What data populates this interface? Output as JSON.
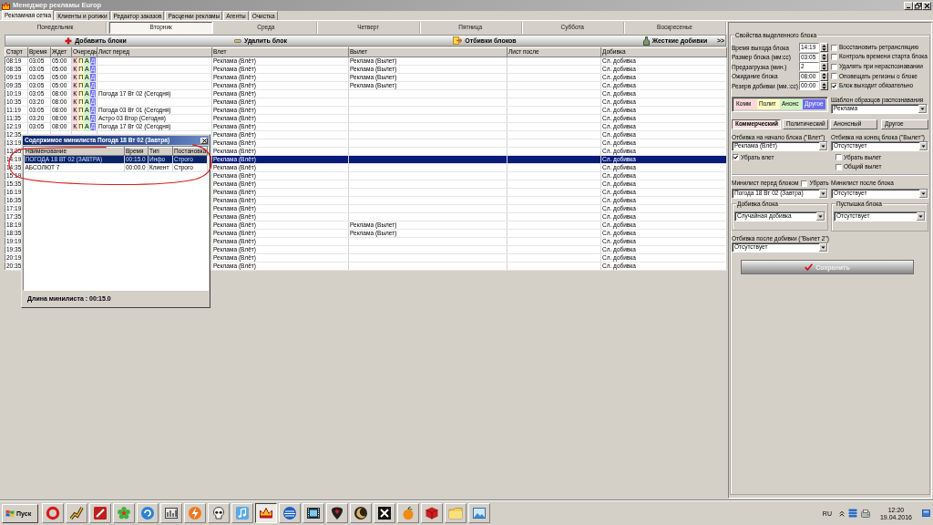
{
  "window": {
    "title": "Менеджер рекламы Europ"
  },
  "tabs": [
    {
      "label": "Рекламная сетка",
      "selected": true
    },
    {
      "label": "Клиенты и ролики",
      "selected": false
    },
    {
      "label": "Редактор заказов",
      "selected": false
    },
    {
      "label": "Расценки рекламы",
      "selected": false
    },
    {
      "label": "Агенты",
      "selected": false
    },
    {
      "label": "Очистка",
      "selected": false
    }
  ],
  "day_tabs": [
    {
      "label": "Понедельник",
      "selected": false
    },
    {
      "label": "Вторник",
      "selected": true
    },
    {
      "label": "Среда",
      "selected": false
    },
    {
      "label": "Четверг",
      "selected": false
    },
    {
      "label": "Пятница",
      "selected": false
    },
    {
      "label": "Суббота",
      "selected": false
    },
    {
      "label": "Воскресенье",
      "selected": false
    }
  ],
  "toolbar": [
    {
      "label": "Добавить блоки",
      "kind": "add"
    },
    {
      "label": "Удалить блок",
      "kind": "delete"
    },
    {
      "label": "Отбивки блоков",
      "kind": "jingles"
    },
    {
      "label": "Жесткие добивки",
      "kind": "fillers"
    },
    {
      "label": ">>",
      "kind": "more"
    }
  ],
  "table": {
    "columns": [
      "Старт",
      "Время",
      "Ждет",
      "Очередь",
      "Лист перед",
      "Влет",
      "Вылет",
      "Лист после",
      "Добивка"
    ],
    "rows": [
      {
        "start": "08:19",
        "time": "03:05",
        "wait": "05:00",
        "queue": [
          "К",
          "П",
          "А",
          "Д"
        ],
        "jingle_in": "Реклама (Влёт)",
        "jingle_out": "Реклама (Вылет)",
        "filler": "Сл. добивка",
        "selected": false
      },
      {
        "start": "08:35",
        "time": "03:05",
        "wait": "05:00",
        "queue": [
          "К",
          "П",
          "А",
          "Д"
        ],
        "jingle_in": "Реклама (Влёт)",
        "jingle_out": "Реклама (Вылет)",
        "filler": "Сл. добивка",
        "selected": false
      },
      {
        "start": "09:19",
        "time": "03:05",
        "wait": "05:00",
        "queue": [
          "К",
          "П",
          "А",
          "Д"
        ],
        "jingle_in": "Реклама (Влёт)",
        "jingle_out": "Реклама (Вылет)",
        "filler": "Сл. добивка",
        "selected": false
      },
      {
        "start": "09:35",
        "time": "03:05",
        "wait": "05:00",
        "queue": [
          "К",
          "П",
          "А",
          "Д"
        ],
        "jingle_in": "Реклама (Влёт)",
        "jingle_out": "Реклама (Вылет)",
        "filler": "Сл. добивка",
        "selected": false
      },
      {
        "start": "10:19",
        "time": "03:05",
        "wait": "08:00",
        "queue": [
          "К",
          "П",
          "А",
          "Д"
        ],
        "list_before": "Погода 17 Вт 02 (Сегодня)",
        "jingle_in": "Реклама (Влёт)",
        "filler": "Сл. добивка",
        "selected": false
      },
      {
        "start": "10:35",
        "time": "03:20",
        "wait": "08:00",
        "queue": [
          "К",
          "П",
          "А",
          "Д"
        ],
        "jingle_in": "Реклама (Влёт)",
        "filler": "Сл. добивка",
        "selected": false
      },
      {
        "start": "11:19",
        "time": "03:05",
        "wait": "08:00",
        "queue": [
          "К",
          "П",
          "А",
          "Д"
        ],
        "list_before": "Погода 03 Вт 01 (Сегодня)",
        "jingle_in": "Реклама (Влёт)",
        "filler": "Сл. добивка",
        "selected": false
      },
      {
        "start": "11:35",
        "time": "03:20",
        "wait": "08:00",
        "queue": [
          "К",
          "П",
          "А",
          "Д"
        ],
        "list_before": "Астро 03 Втор (Сегодня)",
        "jingle_in": "Реклама (Влёт)",
        "filler": "Сл. добивка",
        "selected": false
      },
      {
        "start": "12:19",
        "time": "03:05",
        "wait": "08:00",
        "queue": [
          "К",
          "П",
          "А",
          "Д"
        ],
        "list_before": "Погода 17 Вт 02 (Сегодня)",
        "jingle_in": "Реклама (Влёт)",
        "filler": "Сл. добивка",
        "selected": false
      },
      {
        "start": "12:35",
        "jingle_in": "Реклама (Влёт)",
        "filler": "Сл. добивка",
        "selected": false
      },
      {
        "start": "13:19",
        "jingle_in": "Реклама (Влёт)",
        "filler": "Сл. добивка",
        "selected": false
      },
      {
        "start": "13:35",
        "jingle_in": "Реклама (Влёт)",
        "filler": "Сл. добивка",
        "selected": false
      },
      {
        "start": "14:19",
        "jingle_in": "Реклама (Влёт)",
        "filler": "Сл. добивка",
        "selected": true
      },
      {
        "start": "14:35",
        "jingle_in": "Реклама (Влёт)",
        "filler": "Сл. добивка",
        "selected": false
      },
      {
        "start": "15:19",
        "jingle_in": "Реклама (Влёт)",
        "filler": "Сл. добивка",
        "selected": false
      },
      {
        "start": "15:35",
        "jingle_in": "Реклама (Влёт)",
        "filler": "Сл. добивка",
        "selected": false
      },
      {
        "start": "16:19",
        "jingle_in": "Реклама (Влёт)",
        "filler": "Сл. добивка",
        "selected": false
      },
      {
        "start": "16:35",
        "jingle_in": "Реклама (Влёт)",
        "filler": "Сл. добивка",
        "selected": false
      },
      {
        "start": "17:19",
        "jingle_in": "Реклама (Влёт)",
        "filler": "Сл. добивка",
        "selected": false
      },
      {
        "start": "17:35",
        "jingle_in": "Реклама (Влёт)",
        "filler": "Сл. добивка",
        "selected": false
      },
      {
        "start": "18:19",
        "jingle_in": "Реклама (Влёт)",
        "jingle_out": "Реклама (Вылет)",
        "filler": "Сл. добивка",
        "selected": false
      },
      {
        "start": "18:35",
        "jingle_in": "Реклама (Влёт)",
        "jingle_out": "Реклама (Вылет)",
        "filler": "Сл. добивка",
        "selected": false
      },
      {
        "start": "19:19",
        "jingle_in": "Реклама (Влёт)",
        "filler": "Сл. добивка",
        "selected": false
      },
      {
        "start": "19:35",
        "jingle_in": "Реклама (Влёт)",
        "filler": "Сл. добивка",
        "selected": false
      },
      {
        "start": "20:19",
        "jingle_in": "Реклама (Влёт)",
        "filler": "Сл. добивка",
        "selected": false
      },
      {
        "start": "20:35",
        "jingle_in": "Реклама (Влёт)",
        "filler": "Сл. добивка",
        "selected": false
      }
    ]
  },
  "popup": {
    "title": "Содержимое минилиста Погода 18 Вт 02 (Завтра)",
    "columns": [
      "Наименование",
      "Время",
      "Тип",
      "Постановка"
    ],
    "rows": [
      {
        "name": "ПОГОДА 18 ВТ 02 (ЗАВТРА)",
        "time": "00:15.0",
        "type": "Инфо",
        "placement": "Строго",
        "selected": true
      },
      {
        "name": "АБСОЛЮТ 7",
        "time": "00:00.0",
        "type": "Клиент",
        "placement": "Строго",
        "selected": false
      }
    ],
    "footer": "Длина минилиста : 00:15.0"
  },
  "properties": {
    "title": "Свойства выделенного блока",
    "fields": [
      {
        "label": "Время выхода блока",
        "value": "14:19"
      },
      {
        "label": "Размер блока (мм:сс)",
        "value": "03:05"
      },
      {
        "label": "Предзагрузка (мин.)",
        "value": "2"
      },
      {
        "label": "Ожидание блока",
        "value": "08:00"
      },
      {
        "label": "Резерв добивки (мм.:сс)",
        "value": "00:00"
      }
    ],
    "options": [
      {
        "label": "Восстановить ретрансляцию",
        "checked": false
      },
      {
        "label": "Контроль времени старта блока",
        "checked": false
      },
      {
        "label": "Удалять при нераспознавании",
        "checked": false
      },
      {
        "label": "Оповещать регионы о блоке",
        "checked": false
      },
      {
        "label": "Блок выходит обязательно",
        "checked": true
      }
    ],
    "legend": [
      {
        "label": "Комм",
        "color": "#fcd8d8"
      },
      {
        "label": "Полит",
        "color": "#fcfcc4"
      },
      {
        "label": "Анонс",
        "color": "#d0f4c4"
      },
      {
        "label": "Другое",
        "color": "#6c6cf0"
      }
    ],
    "template": {
      "label": "Шаблон образцов распознавания",
      "value": "Реклама"
    },
    "category_tabs": [
      {
        "label": "Коммерческий",
        "selected": true
      },
      {
        "label": "Политический",
        "selected": false
      },
      {
        "label": "Анонсный",
        "selected": false
      },
      {
        "label": "Другое",
        "selected": false
      }
    ],
    "start_jingle": {
      "label": "Отбивка на начало блока (\"Влет\")",
      "value": "Реклама (Влёт)",
      "options": [
        {
          "label": "Убрать влет",
          "checked": true
        }
      ]
    },
    "end_jingle": {
      "label": "Отбивка на конец блока (\"Вылет\")",
      "value": "Отсутствует",
      "options": [
        {
          "label": "Убрать вылет",
          "checked": false
        },
        {
          "label": "Общий вылет",
          "checked": false
        }
      ]
    },
    "minilist_before": {
      "label": "Минилист перед блоком",
      "value": "Погода 18 Вт 02 (Завтра)",
      "remove": {
        "label": "Убрать",
        "checked": false
      }
    },
    "minilist_after": {
      "label": "Минилист после блока",
      "value": "Отсутствует"
    },
    "filler": {
      "label": "Добивка блока",
      "value": "Случайная добивка"
    },
    "dummy": {
      "label": "Пустышка блока",
      "value": "Отсутствует"
    },
    "after_filler_jingle": {
      "label": "Отбивка после добивки (\"Вылет 2\")",
      "value": "Отсутствует"
    },
    "save_button": "Сохранить"
  },
  "taskbar": {
    "start_label": "Пуск",
    "buttons": [
      {
        "active": false
      },
      {
        "active": false
      },
      {
        "active": false
      },
      {
        "active": false
      },
      {
        "active": false
      },
      {
        "active": false
      },
      {
        "active": false
      },
      {
        "active": false
      },
      {
        "active": false
      },
      {
        "active": true
      },
      {
        "active": false
      },
      {
        "active": false
      },
      {
        "active": false
      },
      {
        "active": false
      },
      {
        "active": false
      },
      {
        "active": false
      },
      {
        "active": false
      },
      {
        "active": false
      },
      {
        "active": false
      }
    ],
    "tray": {
      "language": "RU",
      "time": "12:20",
      "date": "19.04.2016"
    }
  }
}
